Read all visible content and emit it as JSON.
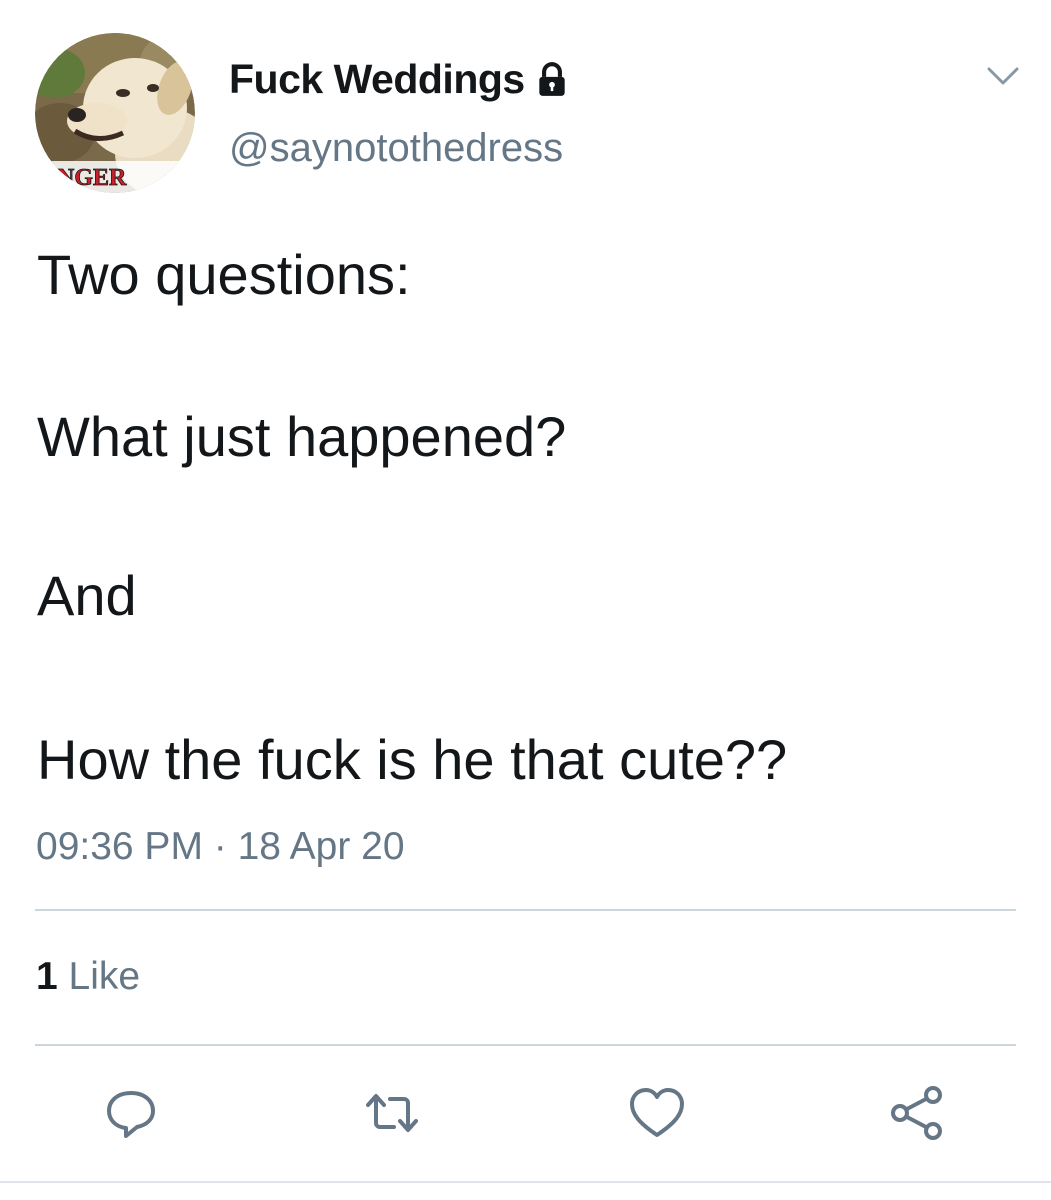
{
  "author": {
    "display_name": "Fuck Weddings",
    "handle": "@saynotothedress",
    "avatar_text": "NGER"
  },
  "tweet": {
    "lines": [
      "Two questions:",
      "What just happened?",
      "And",
      "How the fuck is he that cute??"
    ],
    "timestamp": "09:36 PM · 18 Apr 20"
  },
  "stats": {
    "likes_count": "1",
    "likes_label": "Like"
  },
  "icons": {
    "lock": "lock-icon",
    "caret": "chevron-down-icon",
    "reply": "reply-icon",
    "retweet": "retweet-icon",
    "like": "heart-icon",
    "share": "share-icon"
  },
  "colors": {
    "secondary_text": "#657786",
    "divider": "#ccd6dd",
    "icon": "#657786"
  }
}
